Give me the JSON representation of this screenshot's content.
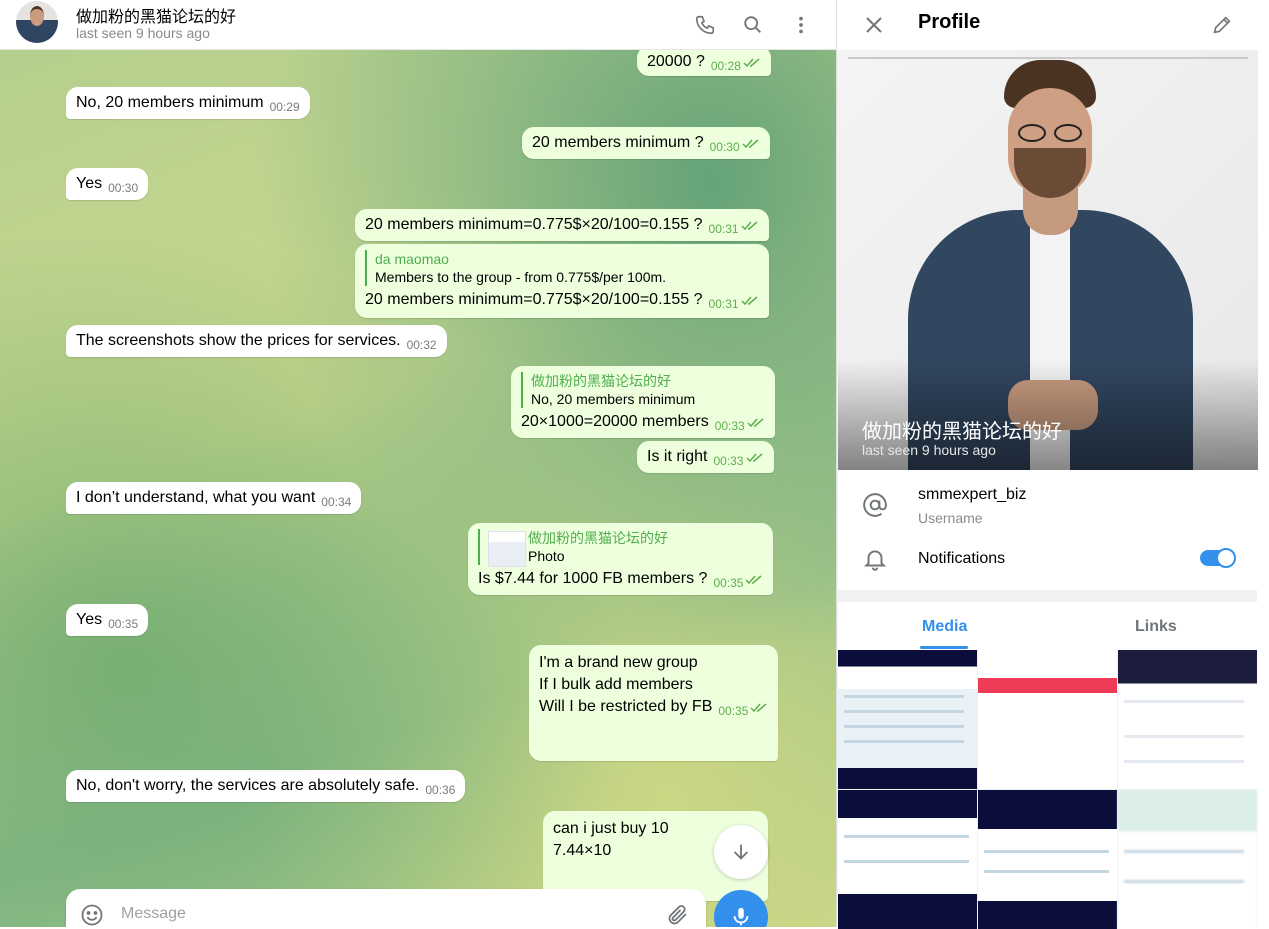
{
  "chat": {
    "title": "做加粉的黑猫论坛的好",
    "status": "last seen 9 hours ago",
    "composer_placeholder": "Message",
    "messages": [
      {
        "text": "20000 ?",
        "time": "00:28"
      },
      {
        "text": "No, 20 members minimum",
        "time": "00:29"
      },
      {
        "text": "20 members minimum ?",
        "time": "00:30"
      },
      {
        "text": "Yes",
        "time": "00:30"
      },
      {
        "text": "20 members minimum=0.775$×20/100=0.155 ?",
        "time": "00:31"
      },
      {
        "reply_name": "da maomao",
        "reply_text": "Members to the group - from 0.775$/per 100m.",
        "text": "20 members minimum=0.775$×20/100=0.155 ?",
        "time": "00:31"
      },
      {
        "text": "The screenshots show the prices for services.",
        "time": "00:32"
      },
      {
        "reply_name": "做加粉的黑猫论坛的好",
        "reply_text": "No, 20 members minimum",
        "text": "20×1000=20000 members",
        "time": "00:33"
      },
      {
        "text": "Is it right",
        "time": "00:33"
      },
      {
        "text": "I don’t understand, what you want",
        "time": "00:34"
      },
      {
        "reply_name": "做加粉的黑猫论坛的好",
        "reply_text": "Photo",
        "text": "Is $7.44 for 1000 FB members ?",
        "time": "00:35"
      },
      {
        "text": "Yes",
        "time": "00:35"
      },
      {
        "line1": "I'm a brand new group",
        "line2": "If I bulk add members",
        "line3": "Will I be restricted by FB",
        "time": "00:35"
      },
      {
        "text": "No, don't worry, the services are absolutely safe.",
        "time": "00:36"
      },
      {
        "line1": "can i just buy 10",
        "line2": "7.44×10"
      }
    ]
  },
  "profile": {
    "title": "Profile",
    "name": "做加粉的黑猫论坛的好",
    "status": "last seen 9 hours ago",
    "username": "smmexpert_biz",
    "username_label": "Username",
    "notifications_label": "Notifications",
    "notifications_on": true,
    "tabs": [
      "Media",
      "Links"
    ],
    "active_tab": "Media"
  },
  "colors": {
    "accent": "#3390ec",
    "outgoing_bubble": "#eeffde",
    "read_ticks": "#5fae4e"
  }
}
